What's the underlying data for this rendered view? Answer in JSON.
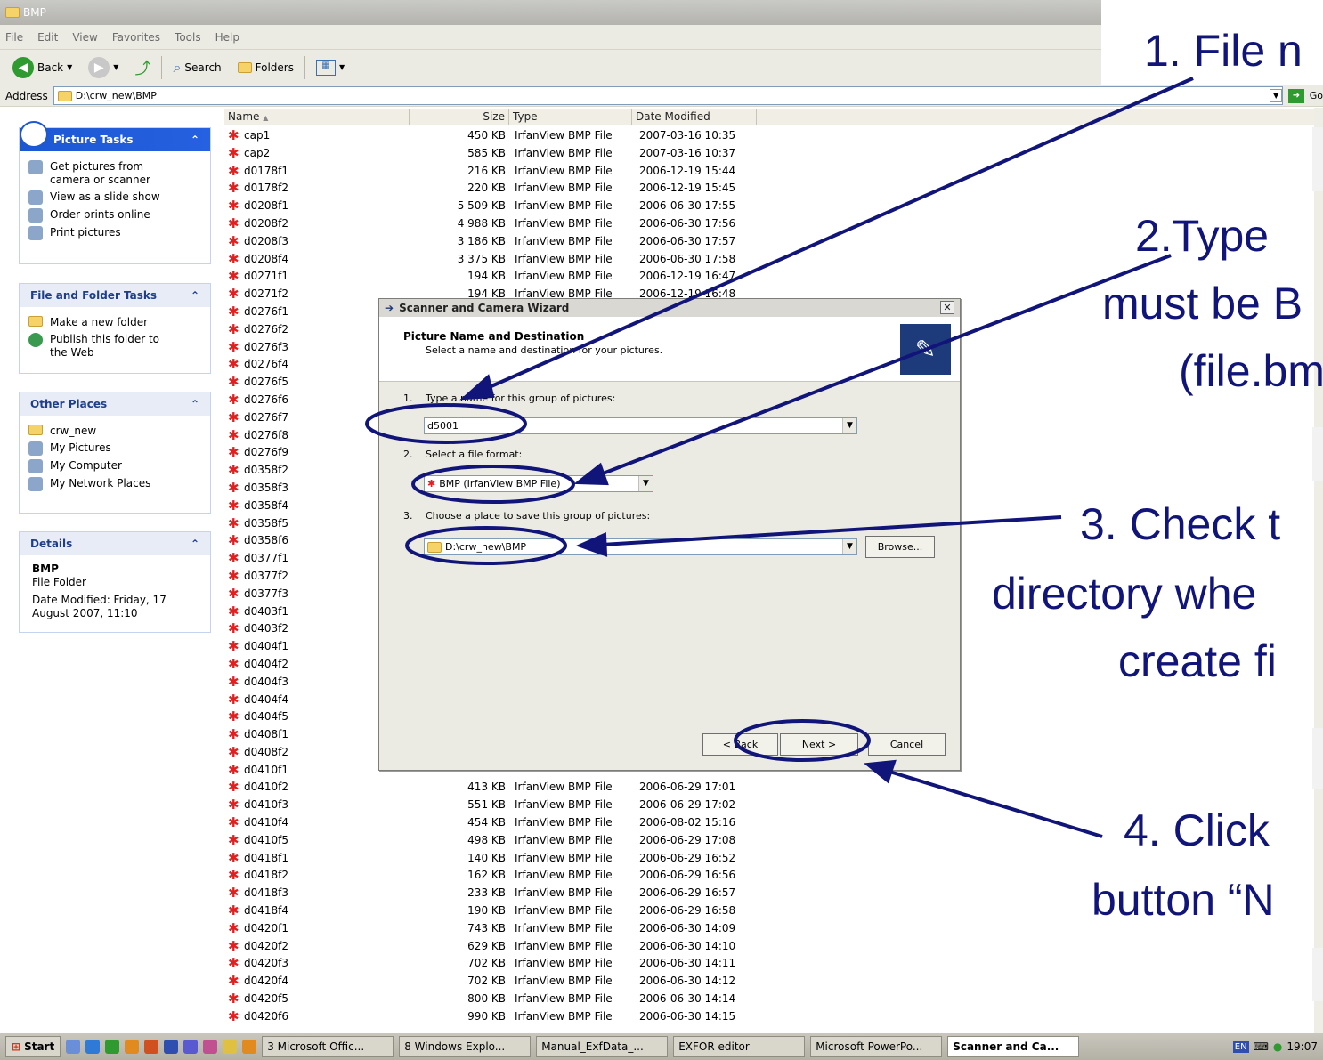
{
  "window": {
    "title": "BMP"
  },
  "menu": [
    "File",
    "Edit",
    "View",
    "Favorites",
    "Tools",
    "Help"
  ],
  "toolbar": {
    "back": "Back",
    "search": "Search",
    "folders": "Folders"
  },
  "address": {
    "label": "Address",
    "value": "D:\\crw_new\\BMP",
    "go": "Go"
  },
  "tasks": {
    "picture_tasks": {
      "title": "Picture Tasks",
      "items": [
        "Get pictures from camera or scanner",
        "View as a slide show",
        "Order prints online",
        "Print pictures"
      ]
    },
    "file_folder_tasks": {
      "title": "File and Folder Tasks",
      "items": [
        "Make a new folder",
        "Publish this folder to the Web"
      ]
    },
    "other_places": {
      "title": "Other Places",
      "items": [
        "crw_new",
        "My Pictures",
        "My Computer",
        "My Network Places"
      ]
    },
    "details": {
      "title": "Details",
      "name": "BMP",
      "kind": "File Folder",
      "modified": "Date Modified: Friday, 17 August 2007, 11:10"
    }
  },
  "columns": {
    "name": "Name",
    "size": "Size",
    "type": "Type",
    "modified": "Date Modified"
  },
  "files": [
    {
      "name": "cap1",
      "size": "450 KB",
      "type": "IrfanView BMP File",
      "date": "2007-03-16 10:35"
    },
    {
      "name": "cap2",
      "size": "585 KB",
      "type": "IrfanView BMP File",
      "date": "2007-03-16 10:37"
    },
    {
      "name": "d0178f1",
      "size": "216 KB",
      "type": "IrfanView BMP File",
      "date": "2006-12-19 15:44"
    },
    {
      "name": "d0178f2",
      "size": "220 KB",
      "type": "IrfanView BMP File",
      "date": "2006-12-19 15:45"
    },
    {
      "name": "d0208f1",
      "size": "5 509 KB",
      "type": "IrfanView BMP File",
      "date": "2006-06-30 17:55"
    },
    {
      "name": "d0208f2",
      "size": "4 988 KB",
      "type": "IrfanView BMP File",
      "date": "2006-06-30 17:56"
    },
    {
      "name": "d0208f3",
      "size": "3 186 KB",
      "type": "IrfanView BMP File",
      "date": "2006-06-30 17:57"
    },
    {
      "name": "d0208f4",
      "size": "3 375 KB",
      "type": "IrfanView BMP File",
      "date": "2006-06-30 17:58"
    },
    {
      "name": "d0271f1",
      "size": "194 KB",
      "type": "IrfanView BMP File",
      "date": "2006-12-19 16:47"
    },
    {
      "name": "d0271f2",
      "size": "194 KB",
      "type": "IrfanView BMP File",
      "date": "2006-12-19 16:48"
    },
    {
      "name": "d0276f1",
      "size": "",
      "type": "",
      "date": ""
    },
    {
      "name": "d0276f2",
      "size": "",
      "type": "",
      "date": ""
    },
    {
      "name": "d0276f3",
      "size": "",
      "type": "",
      "date": ""
    },
    {
      "name": "d0276f4",
      "size": "",
      "type": "",
      "date": ""
    },
    {
      "name": "d0276f5",
      "size": "",
      "type": "",
      "date": ""
    },
    {
      "name": "d0276f6",
      "size": "",
      "type": "",
      "date": ""
    },
    {
      "name": "d0276f7",
      "size": "",
      "type": "",
      "date": ""
    },
    {
      "name": "d0276f8",
      "size": "",
      "type": "",
      "date": ""
    },
    {
      "name": "d0276f9",
      "size": "",
      "type": "",
      "date": ""
    },
    {
      "name": "d0358f2",
      "size": "",
      "type": "",
      "date": ""
    },
    {
      "name": "d0358f3",
      "size": "",
      "type": "",
      "date": ""
    },
    {
      "name": "d0358f4",
      "size": "",
      "type": "",
      "date": ""
    },
    {
      "name": "d0358f5",
      "size": "",
      "type": "",
      "date": ""
    },
    {
      "name": "d0358f6",
      "size": "",
      "type": "",
      "date": ""
    },
    {
      "name": "d0377f1",
      "size": "",
      "type": "",
      "date": ""
    },
    {
      "name": "d0377f2",
      "size": "",
      "type": "",
      "date": ""
    },
    {
      "name": "d0377f3",
      "size": "",
      "type": "",
      "date": ""
    },
    {
      "name": "d0403f1",
      "size": "",
      "type": "",
      "date": ""
    },
    {
      "name": "d0403f2",
      "size": "",
      "type": "",
      "date": ""
    },
    {
      "name": "d0404f1",
      "size": "",
      "type": "",
      "date": ""
    },
    {
      "name": "d0404f2",
      "size": "",
      "type": "",
      "date": ""
    },
    {
      "name": "d0404f3",
      "size": "",
      "type": "",
      "date": ""
    },
    {
      "name": "d0404f4",
      "size": "",
      "type": "",
      "date": ""
    },
    {
      "name": "d0404f5",
      "size": "",
      "type": "",
      "date": ""
    },
    {
      "name": "d0408f1",
      "size": "",
      "type": "",
      "date": ""
    },
    {
      "name": "d0408f2",
      "size": "",
      "type": "",
      "date": ""
    },
    {
      "name": "d0410f1",
      "size": "",
      "type": "",
      "date": ""
    },
    {
      "name": "d0410f2",
      "size": "413 KB",
      "type": "IrfanView BMP File",
      "date": "2006-06-29 17:01"
    },
    {
      "name": "d0410f3",
      "size": "551 KB",
      "type": "IrfanView BMP File",
      "date": "2006-06-29 17:02"
    },
    {
      "name": "d0410f4",
      "size": "454 KB",
      "type": "IrfanView BMP File",
      "date": "2006-08-02 15:16"
    },
    {
      "name": "d0410f5",
      "size": "498 KB",
      "type": "IrfanView BMP File",
      "date": "2006-06-29 17:08"
    },
    {
      "name": "d0418f1",
      "size": "140 KB",
      "type": "IrfanView BMP File",
      "date": "2006-06-29 16:52"
    },
    {
      "name": "d0418f2",
      "size": "162 KB",
      "type": "IrfanView BMP File",
      "date": "2006-06-29 16:56"
    },
    {
      "name": "d0418f3",
      "size": "233 KB",
      "type": "IrfanView BMP File",
      "date": "2006-06-29 16:57"
    },
    {
      "name": "d0418f4",
      "size": "190 KB",
      "type": "IrfanView BMP File",
      "date": "2006-06-29 16:58"
    },
    {
      "name": "d0420f1",
      "size": "743 KB",
      "type": "IrfanView BMP File",
      "date": "2006-06-30 14:09"
    },
    {
      "name": "d0420f2",
      "size": "629 KB",
      "type": "IrfanView BMP File",
      "date": "2006-06-30 14:10"
    },
    {
      "name": "d0420f3",
      "size": "702 KB",
      "type": "IrfanView BMP File",
      "date": "2006-06-30 14:11"
    },
    {
      "name": "d0420f4",
      "size": "702 KB",
      "type": "IrfanView BMP File",
      "date": "2006-06-30 14:12"
    },
    {
      "name": "d0420f5",
      "size": "800 KB",
      "type": "IrfanView BMP File",
      "date": "2006-06-30 14:14"
    },
    {
      "name": "d0420f6",
      "size": "990 KB",
      "type": "IrfanView BMP File",
      "date": "2006-06-30 14:15"
    }
  ],
  "dialog": {
    "title": "Scanner and Camera Wizard",
    "close": "✕",
    "heading": "Picture Name and Destination",
    "subheading": "Select a name and destination for your pictures.",
    "step1": {
      "num": "1.",
      "label": "Type a name for this group of pictures:",
      "value": "d5001"
    },
    "step2": {
      "num": "2.",
      "label": "Select a file format:",
      "value": "BMP (IrfanView BMP File)"
    },
    "step3": {
      "num": "3.",
      "label": "Choose a place to save this group of pictures:",
      "value": "D:\\crw_new\\BMP",
      "browse": "Browse..."
    },
    "buttons": {
      "back": "< Back",
      "next": "Next >",
      "cancel": "Cancel"
    }
  },
  "annotations": {
    "a1": "1. File n",
    "a2": [
      "2.Type",
      "must be B",
      "(file.bm"
    ],
    "a3": [
      "3. Check t",
      "directory whe",
      "create fi"
    ],
    "a4": [
      "4. Click",
      "button “N"
    ]
  },
  "taskbar": {
    "start": "Start",
    "tasks": [
      "3 Microsoft Offic...",
      "8 Windows Explo...",
      "Manual_ExfData_...",
      "EXFOR editor",
      "Microsoft PowerPo...",
      "Scanner and Ca..."
    ],
    "lang": "EN",
    "clock": "19:07"
  },
  "colors": {
    "annotation": "#11157a",
    "xp_blue": "#1d58d3",
    "file_icon": "#e02020"
  }
}
